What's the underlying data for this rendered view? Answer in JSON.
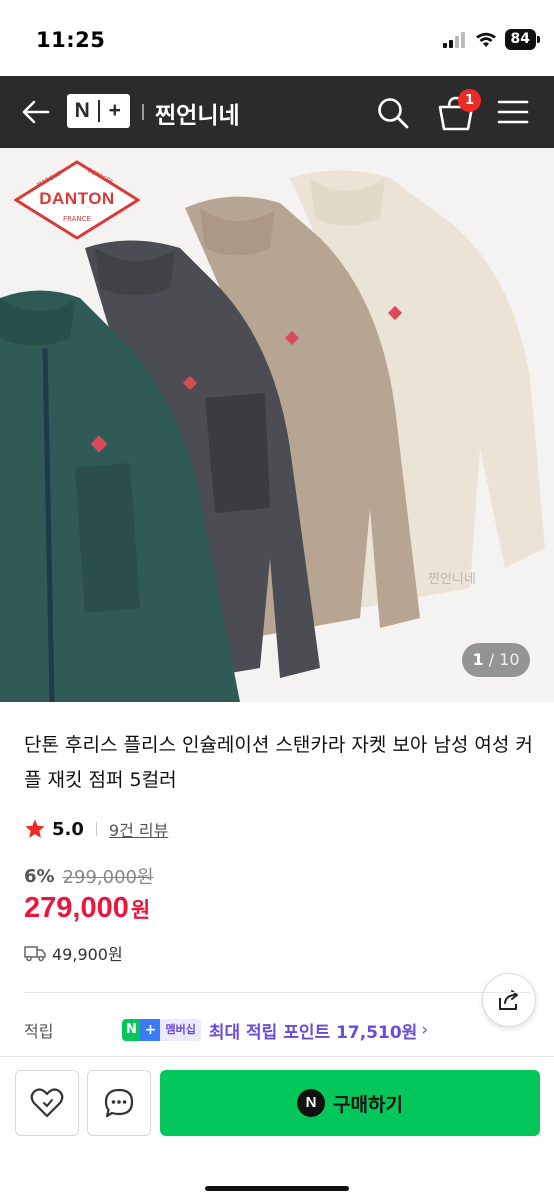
{
  "status_bar": {
    "time": "11:25",
    "battery": "84"
  },
  "header": {
    "logo": "N+",
    "store_name": "찐언니네",
    "cart_count": "1"
  },
  "image": {
    "counter_current": "1",
    "counter_total": "/ 10",
    "brand_logo_top_left": "MARQUE",
    "brand_logo_top_right": "DEPOSÉE",
    "brand_logo_name": "DANTON",
    "brand_logo_bottom": "FRANCE",
    "watermark": "찐언니네",
    "jacket_colors": [
      "#2f5a55",
      "#4b4d52",
      "#b7a594",
      "#ebe4d6"
    ]
  },
  "product": {
    "title": "단톤 후리스 플리스 인슐레이션 스탠카라 자켓 보아 남성 여성 커플 재킷 점퍼 5컬러",
    "rating": "5.0",
    "review_link": "9건 리뷰",
    "discount": "6%",
    "original_price": "299,000원",
    "price": "279,000",
    "price_unit": "원",
    "shipping_fee": "49,900원"
  },
  "points": {
    "label": "적립",
    "membership": "멤버십",
    "text": "최대 적립 포인트 17,510원",
    "chevron": "›"
  },
  "bottom_bar": {
    "buy_n": "N",
    "buy_label": "구매하기"
  },
  "colors": {
    "accent_price": "#e8173b",
    "naver_green": "#03c75a",
    "header_bg": "#2b2b2b",
    "points_purple": "#6a4cd8"
  }
}
